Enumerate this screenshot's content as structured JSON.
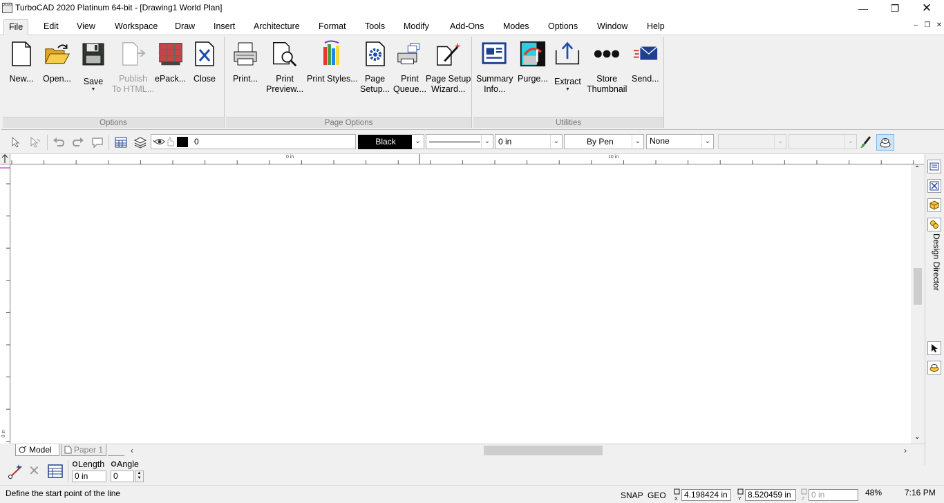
{
  "window": {
    "title": "TurboCAD 2020 Platinum 64-bit - [Drawing1 World Plan]",
    "icon_text": "2020"
  },
  "menu": [
    "File",
    "Edit",
    "View",
    "Workspace",
    "Draw",
    "Insert",
    "Architecture",
    "Format",
    "Tools",
    "Modify",
    "Add-Ons",
    "Modes",
    "Options",
    "Window",
    "Help"
  ],
  "ribbon": {
    "groups": [
      {
        "label": "Options",
        "buttons": [
          {
            "line1": "New...",
            "line2": ""
          },
          {
            "line1": "Open...",
            "line2": ""
          },
          {
            "line1": "Save",
            "line2": ""
          },
          {
            "line1": "Publish",
            "line2": "To HTML..."
          },
          {
            "line1": "ePack...",
            "line2": ""
          },
          {
            "line1": "Close",
            "line2": ""
          }
        ]
      },
      {
        "label": "Page Options",
        "buttons": [
          {
            "line1": "Print...",
            "line2": ""
          },
          {
            "line1": "Print",
            "line2": "Preview..."
          },
          {
            "line1": "Print Styles...",
            "line2": ""
          },
          {
            "line1": "Page",
            "line2": "Setup..."
          },
          {
            "line1": "Print",
            "line2": "Queue..."
          },
          {
            "line1": "Page Setup",
            "line2": "Wizard..."
          }
        ]
      },
      {
        "label": "Utilities",
        "buttons": [
          {
            "line1": "Summary",
            "line2": "Info..."
          },
          {
            "line1": "Purge...",
            "line2": ""
          },
          {
            "line1": "Extract",
            "line2": ""
          },
          {
            "line1": "Store",
            "line2": "Thumbnail"
          },
          {
            "line1": "Send...",
            "line2": ""
          }
        ]
      }
    ]
  },
  "property_toolbar": {
    "layer_value": "0",
    "color_value": "Black",
    "thickness_value": "0 in",
    "pen_style_value": "By Pen",
    "fill_value": "None"
  },
  "ruler": {
    "h_labels": [
      "0 in",
      "10 in"
    ],
    "v_label": "0 in"
  },
  "right_panel": {
    "design_director_label": "Design Director"
  },
  "sheet_tabs": [
    "Model",
    "Paper 1"
  ],
  "inspector": {
    "length_label": "Length",
    "angle_label": "Angle",
    "length_value": "0 in",
    "angle_value": "0"
  },
  "status": {
    "prompt": "Define the start point of the line",
    "snap": "SNAP",
    "geo": "GEO",
    "x_value": "4.198424 in",
    "y_value": "8.520459 in",
    "z_value": "0 in",
    "zoom": "48%",
    "time": "7:16 PM"
  }
}
